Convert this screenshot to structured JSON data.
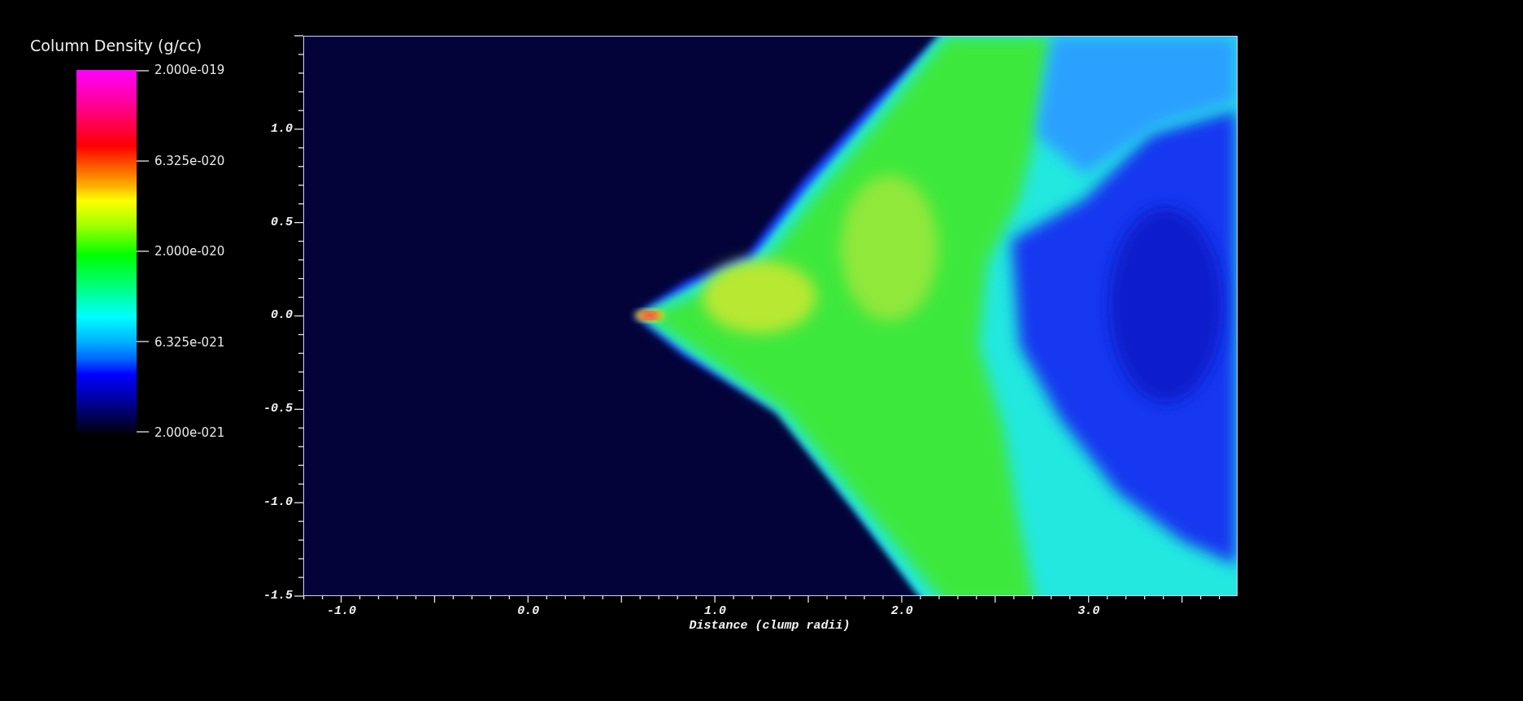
{
  "legend": {
    "title": "Column Density (g/cc)",
    "labels": [
      "2.000e-019",
      "6.325e-020",
      "2.000e-020",
      "6.325e-021",
      "2.000e-021"
    ]
  },
  "plot": {
    "y_ticks": [
      "1.0",
      "0.5",
      "0.0",
      "-0.5",
      "-1.0",
      "-1.5"
    ],
    "x_ticks": [
      "-1.0",
      "0.0",
      "1.0",
      "2.0",
      "3.0"
    ],
    "xlabel": "Distance (clump radii)"
  }
}
